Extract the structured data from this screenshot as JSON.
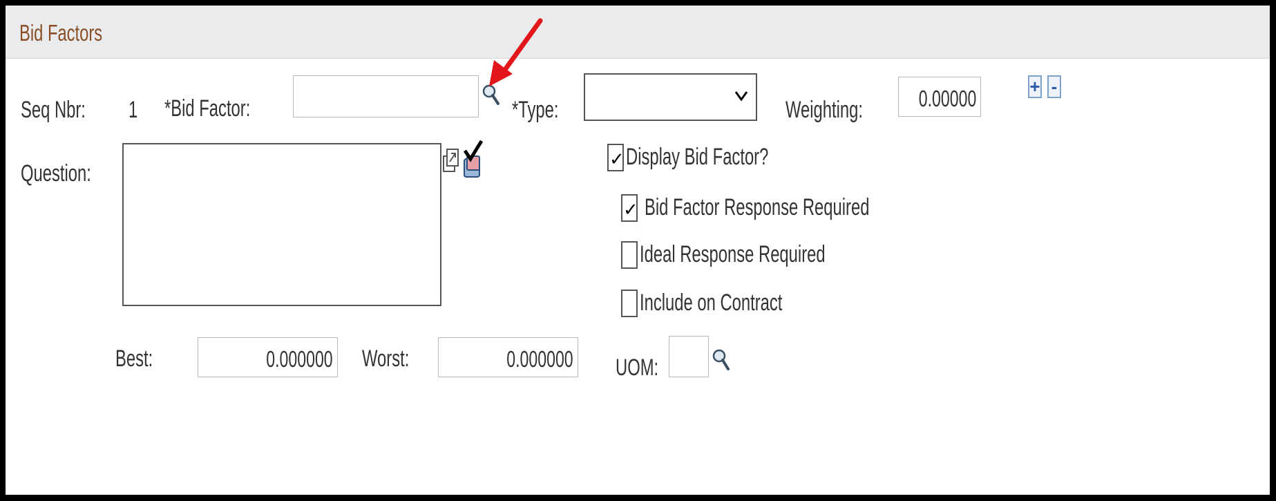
{
  "section": {
    "title": "Bid Factors"
  },
  "seq": {
    "label": "Seq Nbr:",
    "value": "1"
  },
  "bid_factor": {
    "label": "*Bid Factor:",
    "value": ""
  },
  "type": {
    "label": "*Type:",
    "selected": ""
  },
  "weighting": {
    "label": "Weighting:",
    "value": "0.00000"
  },
  "row_controls": {
    "add": "+",
    "remove": "-"
  },
  "question": {
    "label": "Question:",
    "value": ""
  },
  "options": {
    "display_bid_factor": {
      "label": "Display Bid Factor?",
      "checked": true
    },
    "bid_factor_response_required": {
      "label": "Bid Factor Response Required",
      "checked": true
    },
    "ideal_response_required": {
      "label": "Ideal Response Required",
      "checked": false
    },
    "include_on_contract": {
      "label": "Include on Contract",
      "checked": false
    }
  },
  "best": {
    "label": "Best:",
    "value": "0.000000"
  },
  "worst": {
    "label": "Worst:",
    "value": "0.000000"
  },
  "uom": {
    "label": "UOM:",
    "value": ""
  },
  "icons": [
    "search-icon",
    "chevron-down-icon",
    "expand-icon",
    "spell-check-icon",
    "checkmark-icon",
    "annotation-arrow-icon"
  ],
  "colors": {
    "header_bg": "#e9ebec",
    "header_text": "#8a4f26",
    "arrow": "#e3161b",
    "control_blue": "#2b5aa6"
  }
}
